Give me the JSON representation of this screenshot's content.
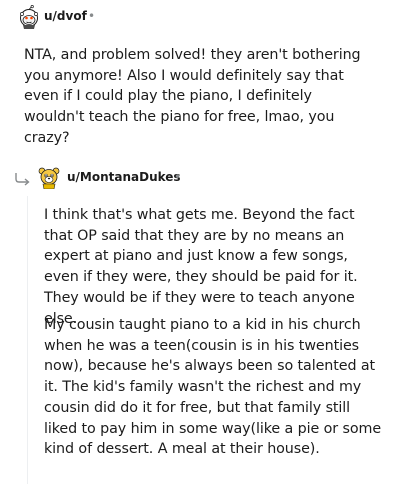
{
  "comments": [
    {
      "username": "u/dvof",
      "separator": "•",
      "avatar_icon": "snoo-avatar-icon",
      "paragraphs": [
        "NTA, and problem solved! they aren't bothering you anymore! Also I would definitely say that even if I could play the piano, I definitely wouldn't teach the piano for free, lmao, you crazy?"
      ]
    },
    {
      "username": "u/MontanaDukes",
      "separator": "•",
      "avatar_icon": "bear-avatar-icon",
      "reply_icon": "reply-arrow-icon",
      "paragraphs": [
        "I think that's what gets me. Beyond the fact that OP said that they are by no means an expert at piano and just know a few songs, even if they were, they should be paid for it. They would be if they were to teach anyone else.",
        "My cousin taught piano to a kid in his church when he was a teen(cousin is in his twenties now), because he's always been so talented at it. The kid's family wasn't the richest and my cousin did do it for free, but that family still liked to pay him in some way(like a pie or some kind of dessert. A meal at their house)."
      ]
    }
  ],
  "colors": {
    "text": "#1c1c1c",
    "meta": "#878a8c",
    "thread_line": "#edeff1"
  }
}
